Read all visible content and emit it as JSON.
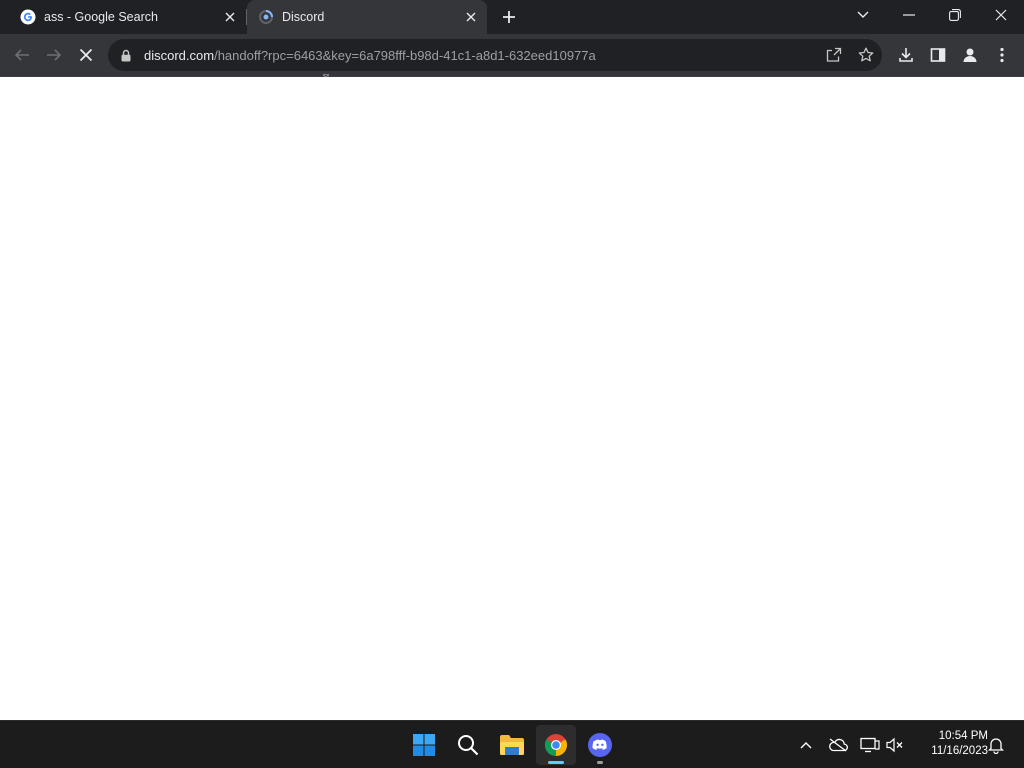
{
  "browser": {
    "tabs": [
      {
        "title": "ass - Google Search",
        "favicon": "google-g-icon",
        "active": false
      },
      {
        "title": "Discord",
        "favicon": "loading-spinner-icon",
        "active": true
      }
    ],
    "address_bar": {
      "host": "discord.com",
      "path": "/handoff?rpc=6463&key=6a798fff-b98d-41c1-a8d1-632eed10977a"
    },
    "nav_icons": [
      "back-arrow-icon",
      "forward-arrow-icon",
      "stop-loading-icon"
    ],
    "toolbar_icons": [
      "share-icon",
      "bookmark-star-icon",
      "download-icon",
      "side-panel-icon",
      "profile-icon",
      "menu-dots-icon"
    ],
    "window_controls": [
      "tab-search-icon",
      "minimize-icon",
      "restore-icon",
      "close-window-icon"
    ]
  },
  "taskbar": {
    "apps": [
      "windows-start-icon",
      "search-icon",
      "file-explorer-icon",
      "chrome-icon",
      "discord-icon"
    ],
    "tray_icons": [
      "show-hidden-icons-chevron",
      "onedrive-icon",
      "network-icon",
      "volume-muted-icon",
      "notifications-bell-icon"
    ],
    "time": "10:54 PM",
    "date": "11/16/2023"
  },
  "colors": {
    "tab_strip": "#202124",
    "toolbar": "#35363a",
    "omnibox": "#202124",
    "taskbar": "#1c1c1c",
    "accent": "#60cdff"
  }
}
